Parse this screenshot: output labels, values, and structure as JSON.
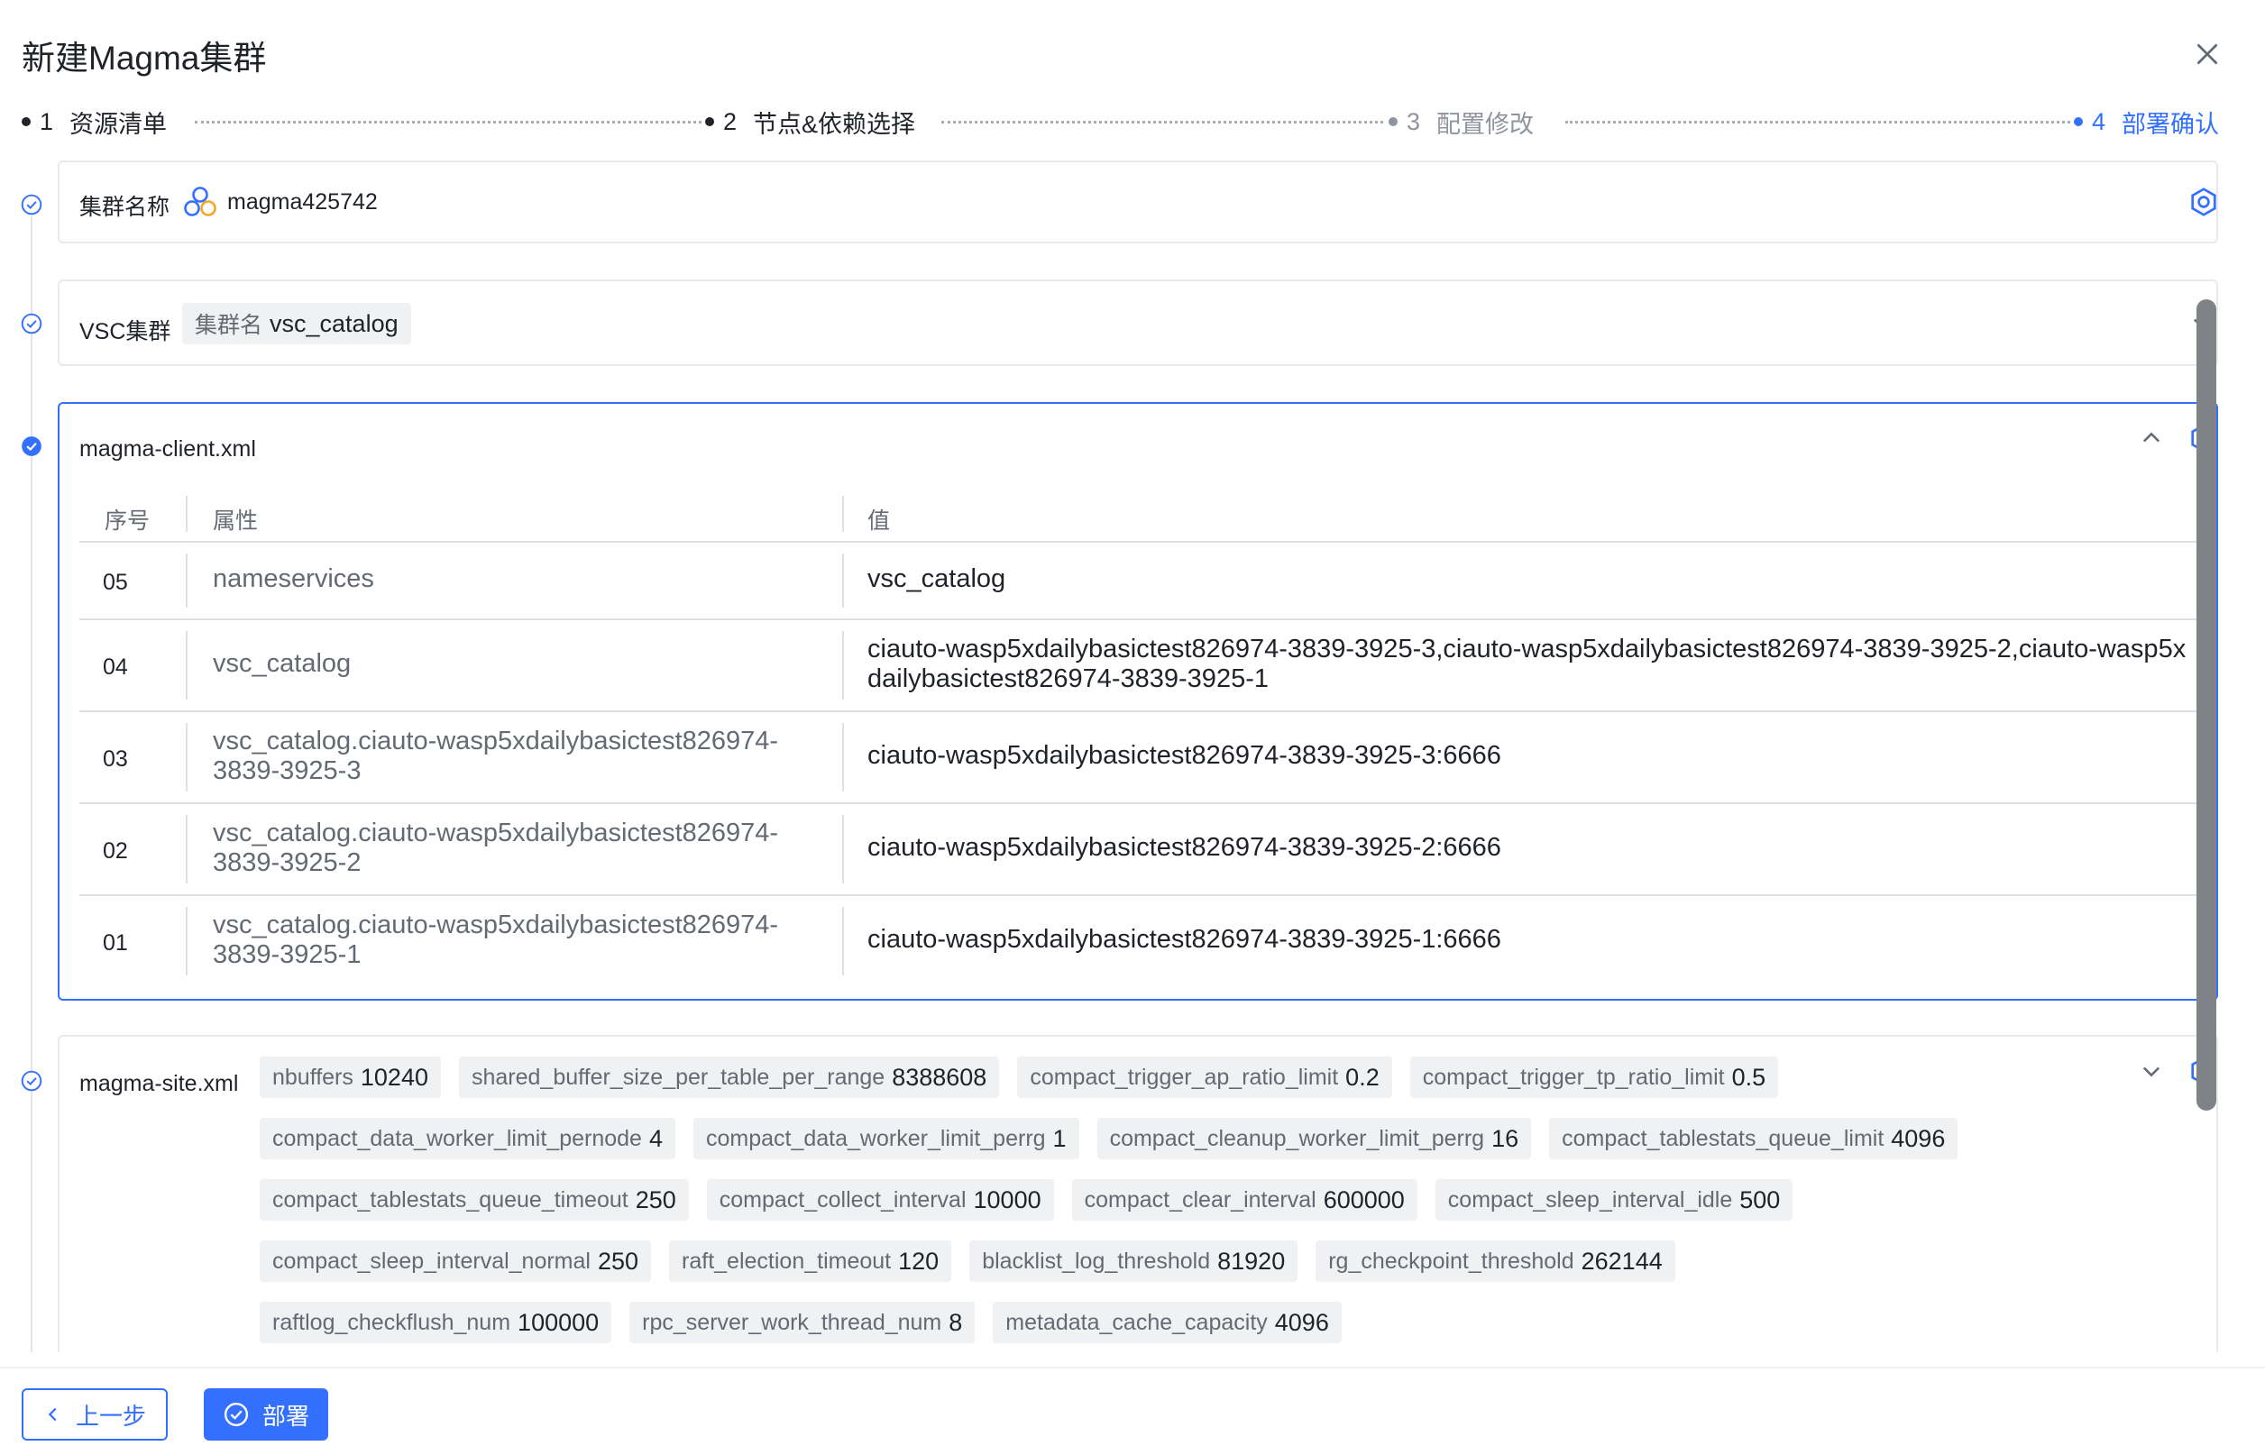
{
  "dialog": {
    "title": "新建Magma集群"
  },
  "steps": [
    {
      "num": "1",
      "label": "资源清单"
    },
    {
      "num": "2",
      "label": "节点&依赖选择"
    },
    {
      "num": "3",
      "label": "配置修改"
    },
    {
      "num": "4",
      "label": "部署确认"
    }
  ],
  "cluster_name": {
    "label": "集群名称",
    "value": "magma425742"
  },
  "vsc": {
    "label": "VSC集群",
    "tag_key": "集群名",
    "tag_value": "vsc_catalog"
  },
  "client_xml": {
    "label": "magma-client.xml",
    "columns": [
      "序号",
      "属性",
      "值"
    ],
    "rows": [
      {
        "idx": "05",
        "prop": "nameservices",
        "val": "vsc_catalog"
      },
      {
        "idx": "04",
        "prop": "vsc_catalog",
        "val": "ciauto-wasp5xdailybasictest826974-3839-3925-3,ciauto-wasp5xdailybasictest826974-3839-3925-2,ciauto-wasp5xdailybasictest826974-3839-3925-1"
      },
      {
        "idx": "03",
        "prop": "vsc_catalog.ciauto-wasp5xdailybasictest826974-3839-3925-3",
        "val": "ciauto-wasp5xdailybasictest826974-3839-3925-3:6666"
      },
      {
        "idx": "02",
        "prop": "vsc_catalog.ciauto-wasp5xdailybasictest826974-3839-3925-2",
        "val": "ciauto-wasp5xdailybasictest826974-3839-3925-2:6666"
      },
      {
        "idx": "01",
        "prop": "vsc_catalog.ciauto-wasp5xdailybasictest826974-3839-3925-1",
        "val": "ciauto-wasp5xdailybasictest826974-3839-3925-1:6666"
      }
    ]
  },
  "site_xml": {
    "label": "magma-site.xml",
    "tags": [
      {
        "k": "nbuffers",
        "v": "10240"
      },
      {
        "k": "shared_buffer_size_per_table_per_range",
        "v": "8388608"
      },
      {
        "k": "compact_trigger_ap_ratio_limit",
        "v": "0.2"
      },
      {
        "k": "compact_trigger_tp_ratio_limit",
        "v": "0.5"
      },
      {
        "k": "compact_data_worker_limit_pernode",
        "v": "4"
      },
      {
        "k": "compact_data_worker_limit_perrg",
        "v": "1"
      },
      {
        "k": "compact_cleanup_worker_limit_perrg",
        "v": "16"
      },
      {
        "k": "compact_tablestats_queue_limit",
        "v": "4096"
      },
      {
        "k": "compact_tablestats_queue_timeout",
        "v": "250"
      },
      {
        "k": "compact_collect_interval",
        "v": "10000"
      },
      {
        "k": "compact_clear_interval",
        "v": "600000"
      },
      {
        "k": "compact_sleep_interval_idle",
        "v": "500"
      },
      {
        "k": "compact_sleep_interval_normal",
        "v": "250"
      },
      {
        "k": "raft_election_timeout",
        "v": "120"
      },
      {
        "k": "blacklist_log_threshold",
        "v": "81920"
      },
      {
        "k": "rg_checkpoint_threshold",
        "v": "262144"
      },
      {
        "k": "raftlog_checkflush_num",
        "v": "100000"
      },
      {
        "k": "rpc_server_work_thread_num",
        "v": "8"
      },
      {
        "k": "metadata_cache_capacity",
        "v": "4096"
      }
    ]
  },
  "footer": {
    "prev_label": "上一步",
    "deploy_label": "部署"
  },
  "colors": {
    "primary": "#3370ff",
    "text": "#1f2329",
    "muted": "#646a73",
    "tag_bg": "#f0f1f2"
  }
}
